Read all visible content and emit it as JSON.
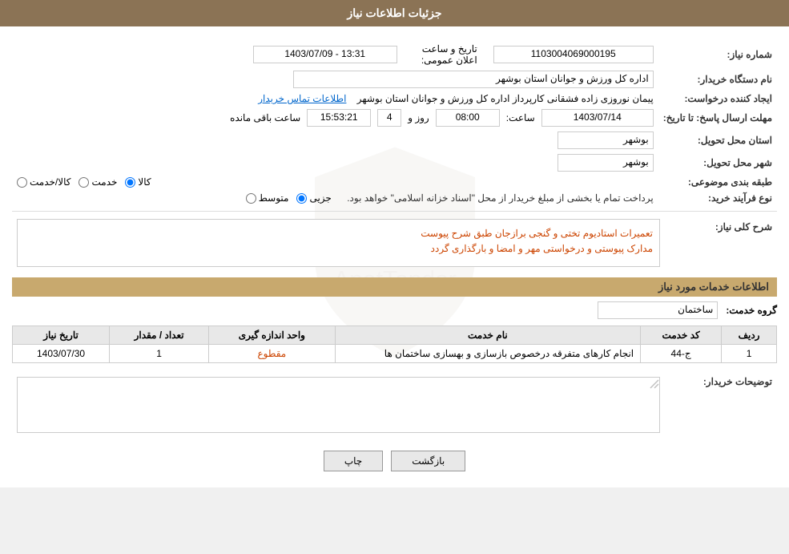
{
  "header": {
    "title": "جزئیات اطلاعات نیاز"
  },
  "fields": {
    "need_number_label": "شماره نیاز:",
    "need_number_value": "1103004069000195",
    "buyer_org_label": "نام دستگاه خریدار:",
    "buyer_org_value": "اداره کل ورزش و جوانان استان بوشهر",
    "requester_label": "ایجاد کننده درخواست:",
    "requester_value": "پیمان نوروزی زاده فشقانی کارپرداز اداره کل ورزش و جوانان استان بوشهر",
    "contact_link": "اطلاعات تماس خریدار",
    "response_deadline_label": "مهلت ارسال پاسخ: تا تاریخ:",
    "response_date": "1403/07/14",
    "response_time_label": "ساعت:",
    "response_time": "08:00",
    "remaining_days_label": "روز و",
    "remaining_days": "4",
    "remaining_time": "15:53:21",
    "remaining_suffix": "ساعت باقی مانده",
    "delivery_province_label": "استان محل تحویل:",
    "delivery_province_value": "بوشهر",
    "delivery_city_label": "شهر محل تحویل:",
    "delivery_city_value": "بوشهر",
    "category_label": "طبقه بندی موضوعی:",
    "category_options": [
      "کالا",
      "خدمت",
      "کالا/خدمت"
    ],
    "category_selected": "کالا",
    "purchase_type_label": "نوع فرآیند خرید:",
    "purchase_options": [
      "جزیی",
      "متوسط"
    ],
    "purchase_note": "پرداخت تمام یا بخشی از مبلغ خریدار از محل \"اسناد خزانه اسلامی\" خواهد بود.",
    "description_section_title": "شرح کلی نیاز:",
    "description_text": "تعمیرات استادیوم تختی و گنجی برازجان طبق شرح پیوست\nمدارک پیوستی و درخواستی مهر و امضا و بارگذاری گردد",
    "service_section_title": "اطلاعات خدمات مورد نیاز",
    "service_group_label": "گروه خدمت:",
    "service_group_value": "ساختمان",
    "table_headers": {
      "row_num": "ردیف",
      "service_code": "کد خدمت",
      "service_name": "نام خدمت",
      "unit": "واحد اندازه گیری",
      "quantity": "تعداد / مقدار",
      "need_date": "تاریخ نیاز"
    },
    "table_rows": [
      {
        "row_num": "1",
        "service_code": "ج-44",
        "service_name": "انجام کارهای متفرقه درخصوص بازسازی و بهسازی ساختمان ها",
        "unit": "مقطوع",
        "quantity": "1",
        "need_date": "1403/07/30"
      }
    ],
    "buyer_notes_label": "توضیحات خریدار:",
    "announce_date_label": "تاریخ و ساعت اعلان عمومی:",
    "announce_date_value": "1403/07/09 - 13:31"
  },
  "buttons": {
    "print": "چاپ",
    "back": "بازگشت"
  }
}
